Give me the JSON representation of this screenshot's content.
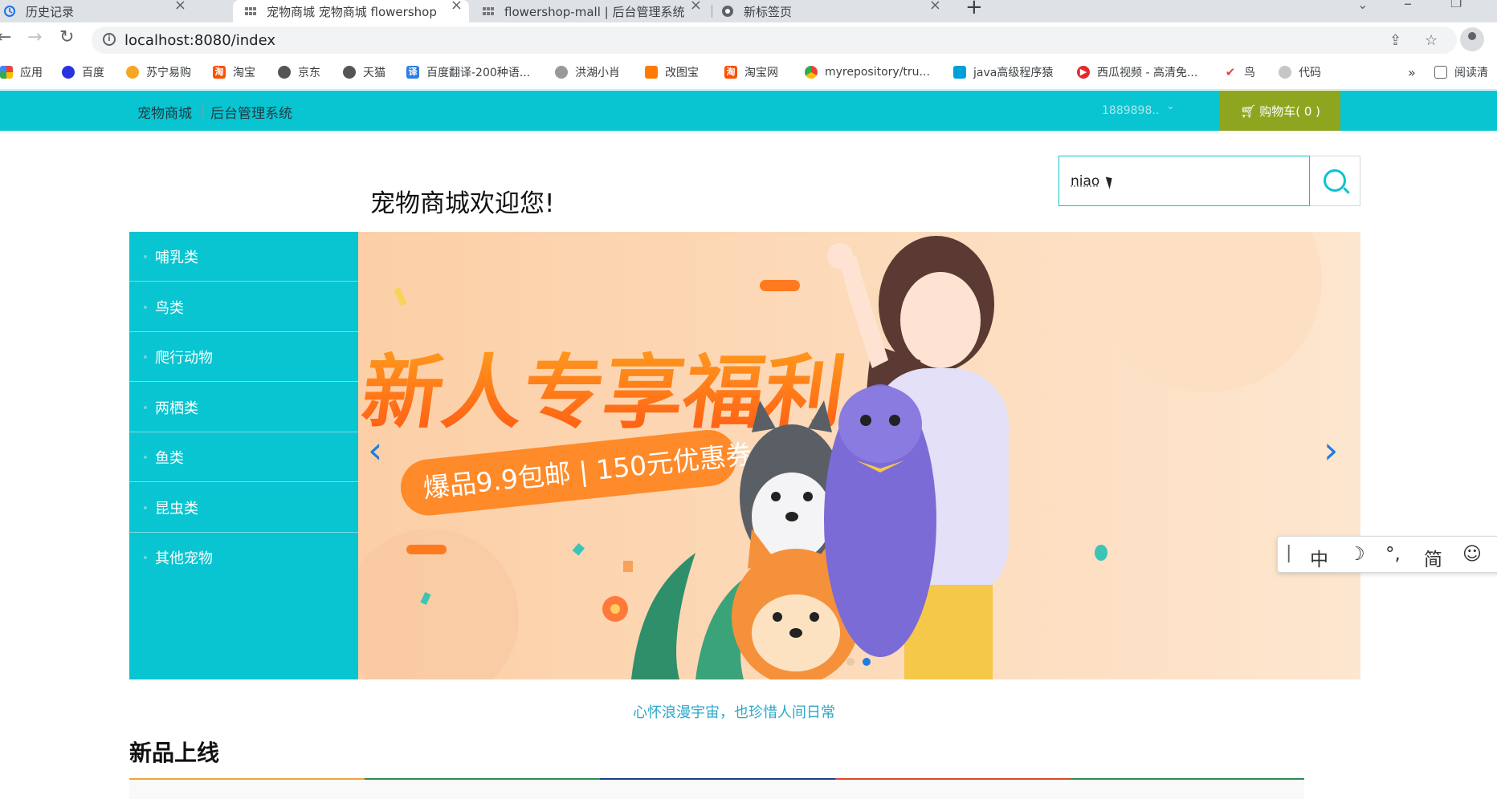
{
  "browser": {
    "tabs": [
      {
        "title": "历史记录",
        "active": false
      },
      {
        "title": "宠物商城 宠物商城 flowershop",
        "active": true
      },
      {
        "title": "flowershop-mall | 后台管理系统",
        "active": false
      },
      {
        "title": "新标签页",
        "active": false
      }
    ],
    "close_glyph": "×",
    "new_tab_glyph": "+",
    "url": "localhost:8080/index",
    "bookmarks": [
      {
        "label": "应用",
        "color": "#e8453c"
      },
      {
        "label": "百度",
        "color": "#2932e1"
      },
      {
        "label": "苏宁易购",
        "color": "#f5a623"
      },
      {
        "label": "淘宝",
        "color": "#ff5000"
      },
      {
        "label": "京东",
        "color": "#555555"
      },
      {
        "label": "天猫",
        "color": "#555555"
      },
      {
        "label": "百度翻译-200种语...",
        "color": "#2f7de1"
      },
      {
        "label": "洪湖小肖",
        "color": "#777777"
      },
      {
        "label": "改图宝",
        "color": "#ff7a00"
      },
      {
        "label": "淘宝网",
        "color": "#ff5000"
      },
      {
        "label": "myrepository/tru...",
        "color": "#34a853"
      },
      {
        "label": "java高级程序猿",
        "color": "#00a1d6"
      },
      {
        "label": "西瓜视频 - 高清免...",
        "color": "#e02b2b"
      },
      {
        "label": "鸟",
        "color": "#e8453c"
      },
      {
        "label": "代码",
        "color": "#c6c6c6"
      }
    ],
    "more_bookmarks": "»",
    "reading_list": "阅读清"
  },
  "header": {
    "nav": [
      "宠物商城",
      "后台管理系统"
    ],
    "user": "1889898..",
    "cart_label": "购物车( 0 )"
  },
  "welcome": "宠物商城欢迎您!",
  "search": {
    "value": "niao"
  },
  "categories": [
    "哺乳类",
    "鸟类",
    "爬行动物",
    "两栖类",
    "鱼类",
    "昆虫类",
    "其他宠物"
  ],
  "banner": {
    "headline": "新人专享福利",
    "subline": "爆品9.9包邮 | 150元优惠券",
    "active_slide": 2,
    "slides_count": 2
  },
  "ime": {
    "items": [
      "中",
      "☽",
      "°,",
      "简",
      "☺"
    ]
  },
  "slogan": "心怀浪漫宇宙，也珍惜人间日常",
  "section_title": "新品上线",
  "colors": {
    "header": "#08c5d1",
    "cart": "#8ea520",
    "arrow": "#1f7de0"
  }
}
